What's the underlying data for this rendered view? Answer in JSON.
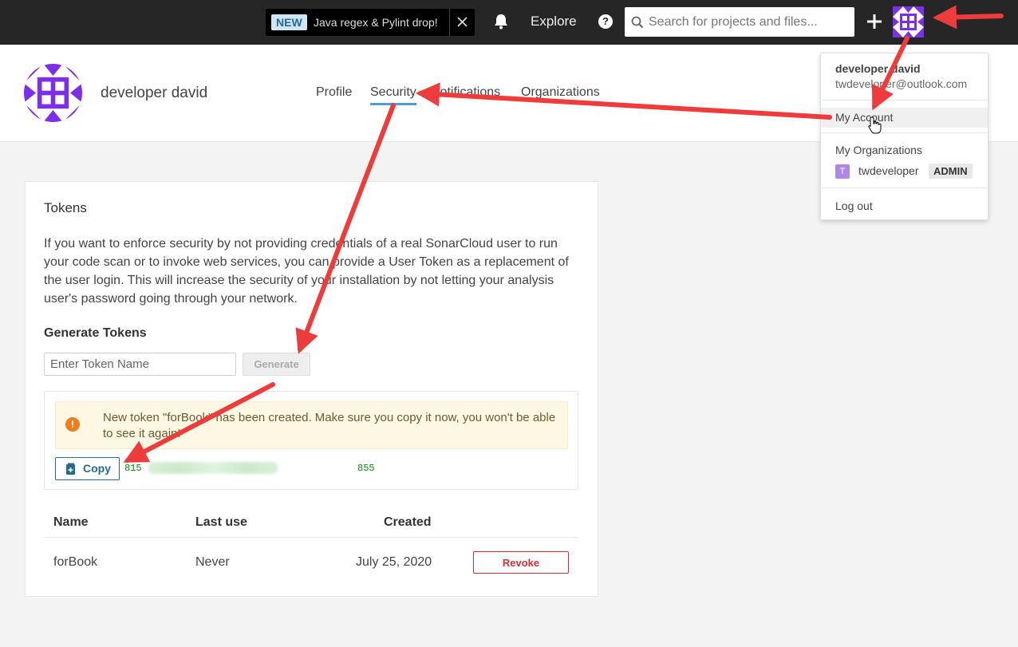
{
  "topbar": {
    "announcement_badge": "NEW",
    "announcement_text": "Java regex & Pylint drop!",
    "explore_label": "Explore",
    "help_glyph": "?",
    "search_placeholder": "Search for projects and files...",
    "icons": [
      "close-icon",
      "bell-icon",
      "help-icon",
      "search-icon",
      "plus-icon",
      "avatar"
    ]
  },
  "header": {
    "user_name": "developer david",
    "tabs": [
      {
        "label": "Profile",
        "active": false
      },
      {
        "label": "Security",
        "active": true
      },
      {
        "label": "Notifications",
        "active": false
      },
      {
        "label": "Organizations",
        "active": false
      }
    ]
  },
  "tokens": {
    "title": "Tokens",
    "description": "If you want to enforce security by not providing credentials of a real SonarCloud user to run your code scan or to invoke web services, you can provide a User Token as a replacement of the user login. This will increase the security of your installation by not letting your analysis user's password going through your network.",
    "generate_title": "Generate Tokens",
    "input_placeholder": "Enter Token Name",
    "generate_label": "Generate",
    "warning_glyph": "!",
    "new_token_message": "New token \"forBook\" has been created. Make sure you copy it now, you won't be able to see it again!",
    "copy_label": "Copy",
    "token_prefix": "815",
    "token_suffix": "855",
    "columns": [
      "Name",
      "Last use",
      "Created"
    ],
    "rows": [
      {
        "name": "forBook",
        "last_use": "Never",
        "created": "July 25, 2020",
        "action": "Revoke"
      }
    ]
  },
  "account_menu": {
    "name": "developer david",
    "email": "twdeveloper@outlook.com",
    "my_account": "My Account",
    "my_organizations": "My Organizations",
    "org_initial": "T",
    "org_name": "twdeveloper",
    "org_role": "ADMIN",
    "log_out": "Log out"
  },
  "colors": {
    "topbar": "#262626",
    "accent": "#4b9fd5",
    "avatar_purple": "#7b2fe8",
    "danger": "#d02f3a",
    "arrow": "#ee3b3b"
  }
}
